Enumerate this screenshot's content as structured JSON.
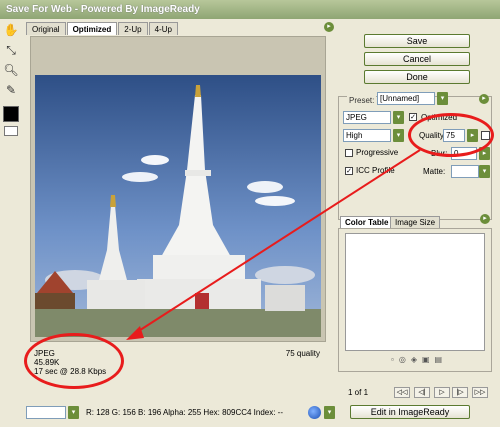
{
  "window": {
    "title": "Save For Web - Powered By ImageReady"
  },
  "tabs": [
    "Original",
    "Optimized",
    "2-Up",
    "4-Up"
  ],
  "tools": {
    "hand": "hand-icon",
    "slice_select": "slice-select-icon",
    "zoom": "zoom-icon",
    "eyedropper": "eyedropper-icon",
    "color_swatch": "#000000",
    "preview": "preview-toggle-icon"
  },
  "buttons": {
    "save": "Save",
    "cancel": "Cancel",
    "done": "Done"
  },
  "settings": {
    "preset_label": "Preset:",
    "preset_value": "[Unnamed]",
    "format": "JPEG",
    "quality_level": "High",
    "optimized_label": "Optimized",
    "optimized": true,
    "quality_label": "Quality:",
    "quality_value": "75",
    "progressive_label": "Progressive",
    "progressive": false,
    "icc_label": "ICC Profile",
    "icc": true,
    "blur_label": "Blur:",
    "blur_value": "0",
    "matte_label": "Matte:"
  },
  "color_panel": {
    "tab_color_table": "Color Table",
    "tab_image_size": "Image Size"
  },
  "pager": {
    "text": "1 of 1"
  },
  "edit_button": "Edit in ImageReady",
  "image_info": {
    "format": "JPEG",
    "size": "45.89K",
    "time": "17 sec @ 28.8 Kbps",
    "quality": "75 quality"
  },
  "bottom_readout": {
    "text": "R:  128   G:  156   B:  196   Alpha:  255   Hex:   809CC4   Index:   --"
  },
  "colors": {
    "annotation_red": "#e81c1c",
    "accent_green": "#6c8e3a",
    "sky": "#809cc4"
  }
}
